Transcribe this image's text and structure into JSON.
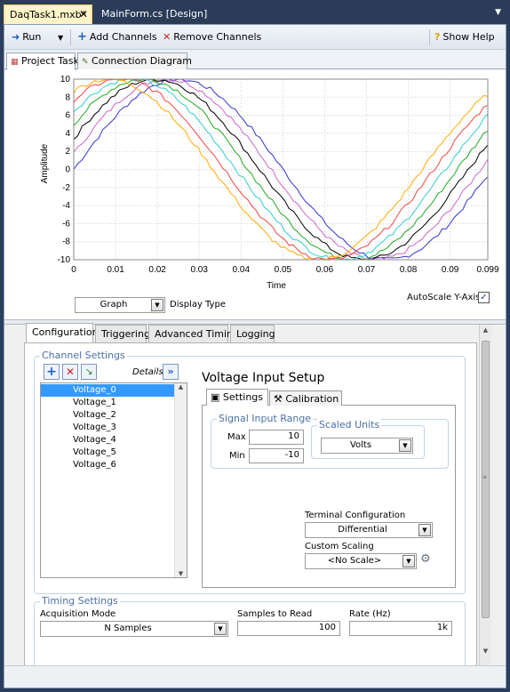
{
  "doc_tabs": [
    {
      "label": "DaqTask1.mxb*"
    },
    {
      "label": "MainForm.cs [Design]"
    }
  ],
  "toolbar": {
    "run_label": "Run",
    "add_channels_label": "Add Channels",
    "remove_channels_label": "Remove Channels",
    "show_help_label": "Show Help"
  },
  "view_tabs": [
    {
      "label": "Project Task"
    },
    {
      "label": "Connection Diagram"
    }
  ],
  "graph": {
    "ylabel": "Amplitude",
    "xlabel": "Time",
    "display_type_label": "Display Type",
    "display_type_value": "Graph",
    "autoscale_label": "AutoScale Y-Axis",
    "autoscale_checked": true
  },
  "chart_data": {
    "type": "line",
    "xlabel": "Time",
    "ylabel": "Amplitude",
    "xlim": [
      0,
      0.099
    ],
    "ylim": [
      -10,
      10
    ],
    "x_ticks": [
      "0",
      "0.01",
      "0.02",
      "0.03",
      "0.04",
      "0.05",
      "0.06",
      "0.07",
      "0.08",
      "0.09",
      "0.099"
    ],
    "y_ticks": [
      "10",
      "8",
      "6",
      "4",
      "2",
      "0",
      "-2",
      "-4",
      "-6",
      "-8",
      "-10"
    ],
    "grid": true,
    "series": [
      {
        "color": "#3333cc",
        "amplitude": 10,
        "period": 0.1,
        "phase_deg": 0
      },
      {
        "color": "#cc66cc",
        "amplitude": 10,
        "period": 0.1,
        "phase_deg": 10
      },
      {
        "color": "#000000",
        "amplitude": 10,
        "period": 0.1,
        "phase_deg": 20
      },
      {
        "color": "#22aa22",
        "amplitude": 10,
        "period": 0.1,
        "phase_deg": 30
      },
      {
        "color": "#33cccc",
        "amplitude": 10,
        "period": 0.1,
        "phase_deg": 40
      },
      {
        "color": "#ee4444",
        "amplitude": 10,
        "period": 0.1,
        "phase_deg": 50
      },
      {
        "color": "#ffaa00",
        "amplitude": 10,
        "period": 0.1,
        "phase_deg": 60
      }
    ]
  },
  "config_tabs": [
    {
      "label": "Configuration"
    },
    {
      "label": "Triggering"
    },
    {
      "label": "Advanced Timing"
    },
    {
      "label": "Logging"
    }
  ],
  "channel_settings": {
    "title": "Channel Settings",
    "details_label": "Details",
    "channels": [
      "Voltage_0",
      "Voltage_1",
      "Voltage_2",
      "Voltage_3",
      "Voltage_4",
      "Voltage_5",
      "Voltage_6"
    ],
    "selected_index": 0
  },
  "voltage_setup": {
    "title": "Voltage Input Setup",
    "tabs": [
      {
        "label": "Settings"
      },
      {
        "label": "Calibration"
      }
    ],
    "signal_range_title": "Signal Input Range",
    "max_label": "Max",
    "max_value": "10",
    "min_label": "Min",
    "min_value": "-10",
    "scaled_units_title": "Scaled Units",
    "scaled_units_value": "Volts",
    "terminal_config_label": "Terminal Configuration",
    "terminal_config_value": "Differential",
    "custom_scaling_label": "Custom Scaling",
    "custom_scaling_value": "<No Scale>"
  },
  "timing_settings": {
    "title": "Timing Settings",
    "acq_mode_label": "Acquisition Mode",
    "acq_mode_value": "N Samples",
    "samples_label": "Samples to Read",
    "samples_value": "100",
    "rate_label": "Rate (Hz)",
    "rate_value": "1k"
  }
}
